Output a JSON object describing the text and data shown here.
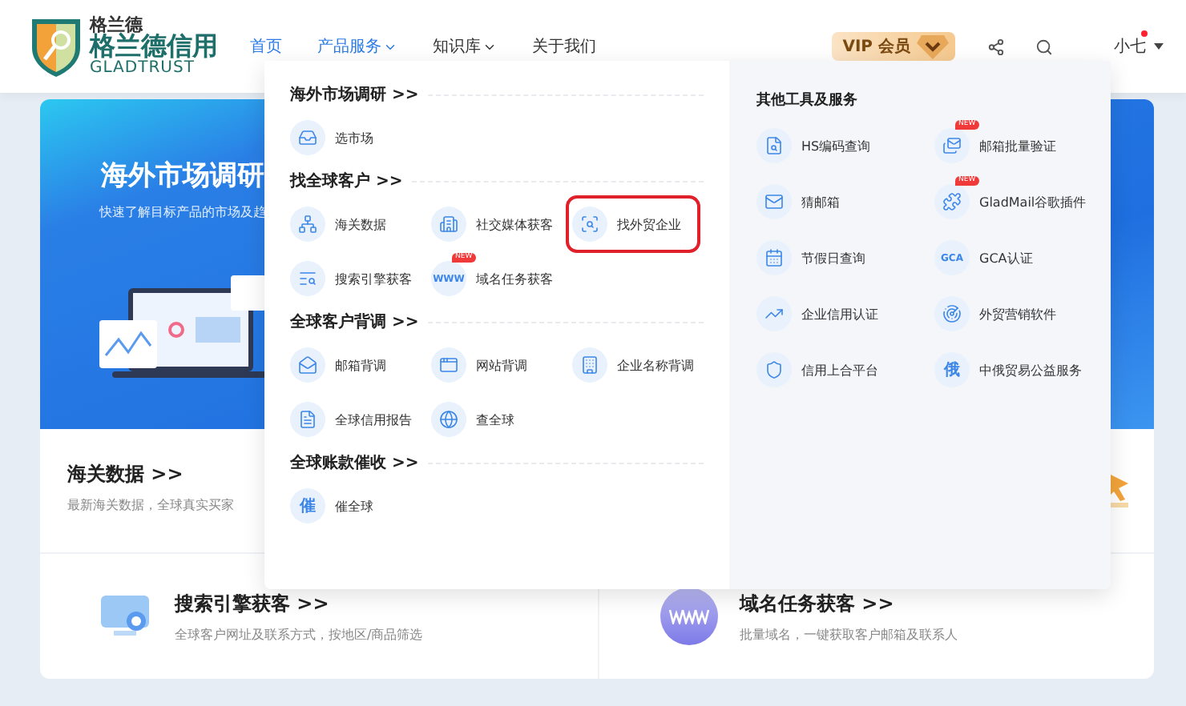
{
  "logo": {
    "small": "格兰德",
    "name": "格兰德信用",
    "latin": "GLADTRUST"
  },
  "nav": [
    {
      "label": "首页",
      "kind": "link",
      "active": true
    },
    {
      "label": "产品服务",
      "kind": "menu",
      "active": true
    },
    {
      "label": "知识库",
      "kind": "menu",
      "active": false
    },
    {
      "label": "关于我们",
      "kind": "link",
      "active": false
    }
  ],
  "vip": {
    "label": "VIP 会员"
  },
  "user": {
    "name": "小七",
    "unread": true
  },
  "hero": {
    "title": "海外市场调研",
    "subtitle": "快速了解目标产品的市场及趋"
  },
  "customs": {
    "title": "海关数据 >>",
    "desc": "最新海关数据，全球真实买家"
  },
  "features": [
    {
      "title": "搜索引擎获客 >>",
      "desc": "全球客户网址及联系方式，按地区/商品筛选"
    },
    {
      "title": "域名任务获客 >>",
      "desc": "批量域名，一键获取客户邮箱及联系人"
    }
  ],
  "menu": {
    "sections": [
      {
        "title": "海外市场调研 >>",
        "items": [
          {
            "label": "选市场",
            "highlighted": false
          }
        ]
      },
      {
        "title": "找全球客户 >>",
        "items": [
          {
            "label": "海关数据",
            "highlighted": false
          },
          {
            "label": "社交媒体获客",
            "highlighted": false
          },
          {
            "label": "找外贸企业",
            "highlighted": true
          },
          {
            "label": "搜索引擎获客",
            "highlighted": false
          },
          {
            "label": "域名任务获客",
            "icon_text": "WWW",
            "badge": "NEW",
            "highlighted": false
          }
        ]
      },
      {
        "title": "全球客户背调 >>",
        "items": [
          {
            "label": "邮箱背调",
            "highlighted": false
          },
          {
            "label": "网站背调",
            "highlighted": false
          },
          {
            "label": "企业名称背调",
            "highlighted": false
          },
          {
            "label": "全球信用报告",
            "highlighted": false
          },
          {
            "label": "查全球",
            "highlighted": false
          }
        ]
      },
      {
        "title": "全球账款催收 >>",
        "items": [
          {
            "label": "催全球",
            "icon_text": "催",
            "highlighted": false
          }
        ]
      }
    ],
    "tools": {
      "title": "其他工具及服务",
      "items": [
        {
          "label": "HS编码查询"
        },
        {
          "label": "邮箱批量验证",
          "badge": "NEW"
        },
        {
          "label": "猜邮箱"
        },
        {
          "label": "GladMail谷歌插件",
          "badge": "NEW"
        },
        {
          "label": "节假日查询"
        },
        {
          "label": "GCA认证",
          "icon_text": "GCA"
        },
        {
          "label": "企业信用认证"
        },
        {
          "label": "外贸营销软件"
        },
        {
          "label": "信用上合平台"
        },
        {
          "label": "中俄贸易公益服务",
          "icon_text": "俄"
        }
      ]
    }
  }
}
